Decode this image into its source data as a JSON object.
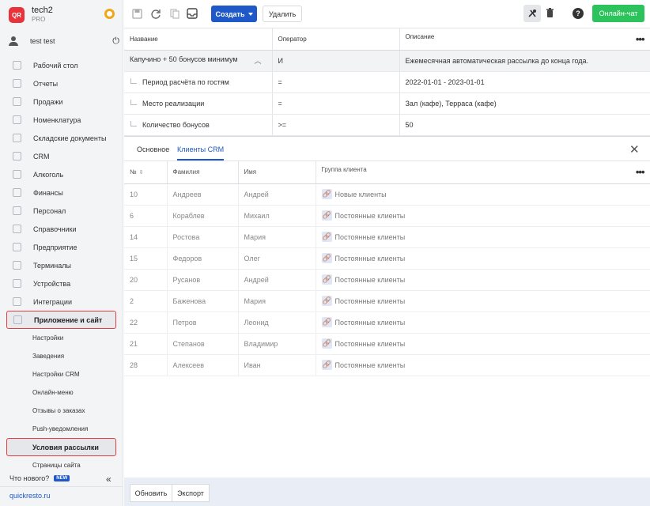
{
  "brand": {
    "logo_text": "QR",
    "name": "tech2",
    "plan": "PRO"
  },
  "user": {
    "name": "test test",
    "power_glyph": "⏻"
  },
  "sidebar": {
    "items": [
      {
        "label": "Рабочий стол",
        "icon": "dashboard-icon"
      },
      {
        "label": "Отчеты",
        "icon": "reports-icon"
      },
      {
        "label": "Продажи",
        "icon": "sales-icon"
      },
      {
        "label": "Номенклатура",
        "icon": "tag-icon"
      },
      {
        "label": "Складские документы",
        "icon": "warehouse-icon"
      },
      {
        "label": "CRM",
        "icon": "crm-icon"
      },
      {
        "label": "Алкоголь",
        "icon": "glass-icon"
      },
      {
        "label": "Финансы",
        "icon": "finance-icon"
      },
      {
        "label": "Персонал",
        "icon": "staff-icon"
      },
      {
        "label": "Справочники",
        "icon": "book-icon"
      },
      {
        "label": "Предприятие",
        "icon": "enterprise-icon"
      },
      {
        "label": "Терминалы",
        "icon": "terminal-icon"
      },
      {
        "label": "Устройства",
        "icon": "printer-icon"
      },
      {
        "label": "Интеграции",
        "icon": "integration-icon"
      },
      {
        "label": "Приложение и сайт",
        "icon": "app-icon"
      }
    ],
    "subitems": [
      {
        "label": "Настройки"
      },
      {
        "label": "Заведения"
      },
      {
        "label": "Настройки CRM"
      },
      {
        "label": "Онлайн-меню"
      },
      {
        "label": "Отзывы о заказах"
      },
      {
        "label": "Push-уведомления"
      },
      {
        "label": "Условия рассылки"
      },
      {
        "label": "Страницы сайта"
      }
    ],
    "whatsnew": "Что нового?",
    "new_badge": "NEW",
    "collapse_glyph": "«",
    "site_link": "quickresto.ru"
  },
  "toolbar": {
    "create_label": "Создать",
    "delete_label": "Удалить",
    "chat_label": "Онлайн-чат",
    "help_glyph": "?"
  },
  "rules_table": {
    "headers": [
      "Название",
      "Оператор",
      "Описание"
    ],
    "rows": [
      {
        "name": "Капучино + 50 бонусов минимум",
        "operator": "И",
        "description": "Ежемесячная автоматическая рассылка до конца года."
      },
      {
        "name": "Период расчёта по гостям",
        "operator": "=",
        "description": "2022-01-01 - 2023-01-01"
      },
      {
        "name": "Место реализации",
        "operator": "=",
        "description": "Зал (кафе), Терраса (кафе)"
      },
      {
        "name": "Количество бонусов",
        "operator": ">=",
        "description": "50"
      }
    ]
  },
  "tabs": [
    {
      "label": "Основное"
    },
    {
      "label": "Клиенты CRM"
    }
  ],
  "clients_table": {
    "headers": [
      "№",
      "Фамилия",
      "Имя",
      "Группа клиента"
    ],
    "rows": [
      {
        "num": "10",
        "last": "Андреев",
        "first": "Андрей",
        "group": "Новые клиенты"
      },
      {
        "num": "6",
        "last": "Кораблев",
        "first": "Михаил",
        "group": "Постоянные клиенты"
      },
      {
        "num": "14",
        "last": "Ростова",
        "first": "Мария",
        "group": "Постоянные клиенты"
      },
      {
        "num": "15",
        "last": "Федоров",
        "first": "Олег",
        "group": "Постоянные клиенты"
      },
      {
        "num": "20",
        "last": "Русанов",
        "first": "Андрей",
        "group": "Постоянные клиенты"
      },
      {
        "num": "2",
        "last": "Баженова",
        "first": "Мария",
        "group": "Постоянные клиенты"
      },
      {
        "num": "22",
        "last": "Петров",
        "first": "Леонид",
        "group": "Постоянные клиенты"
      },
      {
        "num": "21",
        "last": "Степанов",
        "first": "Владимир",
        "group": "Постоянные клиенты"
      },
      {
        "num": "28",
        "last": "Алексеев",
        "first": "Иван",
        "group": "Постоянные клиенты"
      }
    ]
  },
  "footer": {
    "refresh_label": "Обновить",
    "export_label": "Экспорт"
  },
  "colors": {
    "accent": "#1e58c9",
    "chat": "#2dc35c",
    "logo": "#e8333b",
    "highlight_border": "#e24141"
  }
}
